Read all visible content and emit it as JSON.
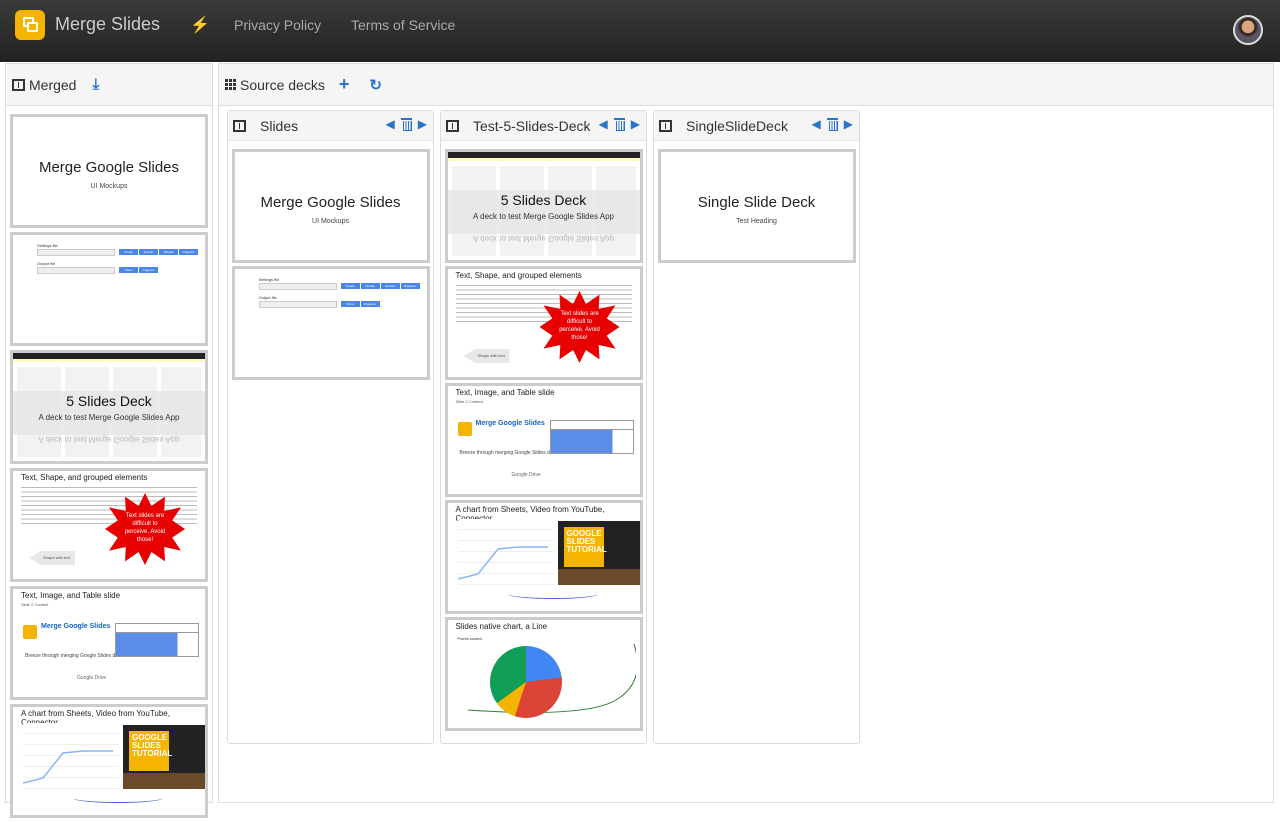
{
  "app": {
    "name": "Merge Slides",
    "nav_links": [
      "Privacy Policy",
      "Terms of Service"
    ]
  },
  "merged_panel": {
    "title": "Merged"
  },
  "source_panel": {
    "title": "Source decks"
  },
  "decks": [
    {
      "title": "Slides"
    },
    {
      "title": "Test-5-Slides-Deck"
    },
    {
      "title": "SingleSlideDeck"
    }
  ],
  "slides": {
    "title_slide": {
      "title": "Merge Google Slides",
      "subtitle": "UI Mockups"
    },
    "settings_form": {
      "settings_label": "Settings file",
      "output_label": "Output file",
      "buttons_top": [
        "Create",
        "Include",
        "Reload",
        "Organize"
      ],
      "buttons_bottom": [
        "Show",
        "Organize"
      ]
    },
    "five_slides": {
      "title": "5 Slides Deck",
      "subtitle": "A deck to test Merge Google Slides App",
      "mirror": "A deck to test Merge Google Slides App"
    },
    "shapes": {
      "title": "Text, Shape, and grouped elements",
      "burst_text": "Text slides are difficult to perceive. Avoid those!",
      "arrow_label": "Shape with text"
    },
    "image_table": {
      "title": "Text, Image, and Table slide",
      "content": "Slide 2 Content",
      "brand": "Merge Google Slides",
      "desc": "Breeze through merging Google Slides decks",
      "drive": "Google Drive"
    },
    "chart_video": {
      "title": "A chart from Sheets, Video from YouTube, Connector",
      "video_text": "GOOGLE SLIDES TUTORIAL"
    },
    "native_chart": {
      "title": "Slides native chart, a Line",
      "chart_label": "Points scored"
    },
    "single": {
      "title": "Single Slide Deck",
      "subtitle": "Test Heading"
    }
  },
  "colors": {
    "accent": "#2a74c9",
    "brand": "#f4b400",
    "navbar": "#2b2b2b"
  }
}
